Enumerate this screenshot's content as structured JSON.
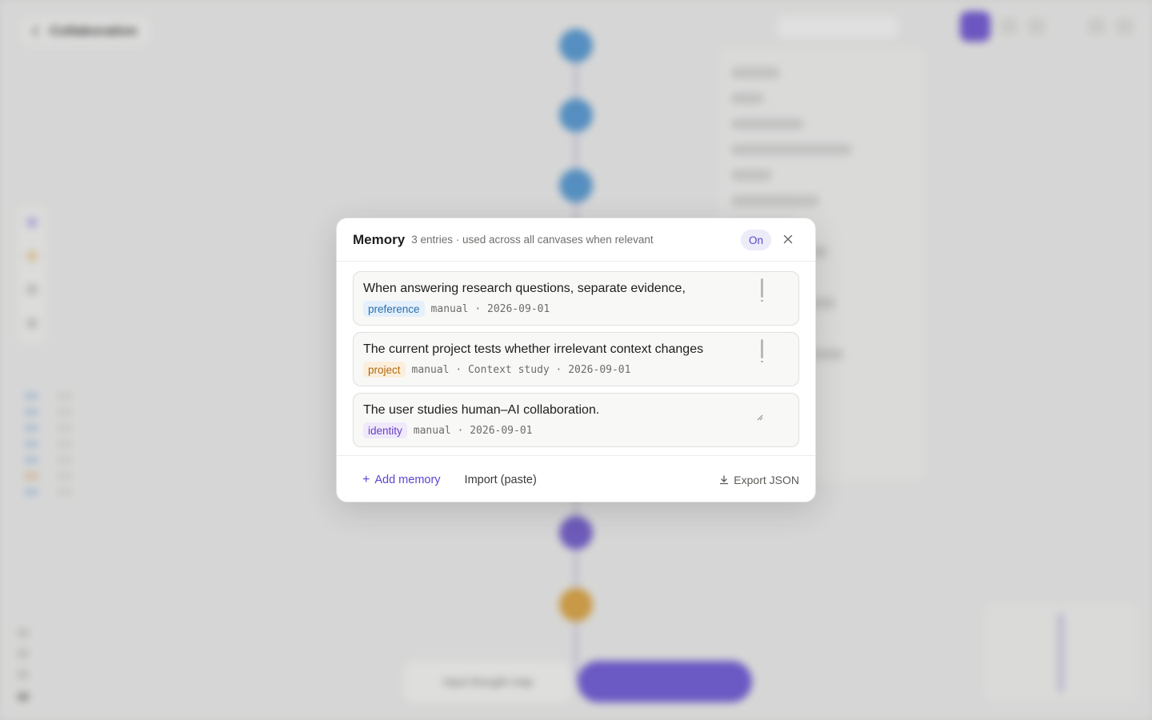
{
  "background": {
    "title": "Collaboration",
    "composer_label": "Input thought map"
  },
  "modal": {
    "title": "Memory",
    "subtitle": "3 entries · used across all canvases when relevant",
    "toggle_label": "On",
    "close_icon": "close-icon",
    "entries": [
      {
        "text": "When answering research questions, separate evidence,",
        "tag": "preference",
        "meta": "manual · 2026-09-01"
      },
      {
        "text": "The current project tests whether irrelevant context changes",
        "tag": "project",
        "meta": "manual · Context study · 2026-09-01"
      },
      {
        "text": "The user studies human–AI collaboration.",
        "tag": "identity",
        "meta": "manual · 2026-09-01"
      }
    ],
    "footer": {
      "add_label": "Add memory",
      "import_label": "Import (paste)",
      "export_label": "Export JSON"
    }
  },
  "colors": {
    "accent": "#5b45d3",
    "tag_preference": "#2c6fb0",
    "tag_project": "#b06a13",
    "tag_identity": "#6b3fc7"
  }
}
